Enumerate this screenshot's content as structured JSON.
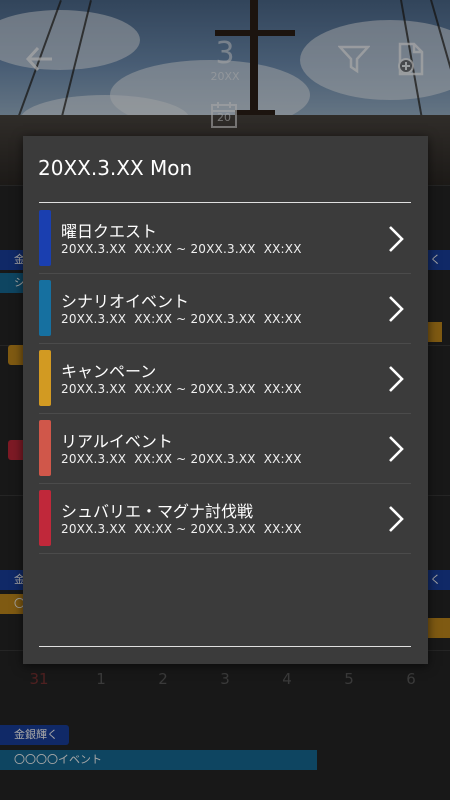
{
  "header": {
    "month": "3",
    "year": "20XX",
    "calendar_icon_day": "20",
    "icons": [
      "back-arrow-icon",
      "filter-icon",
      "add-page-icon",
      "calendar-icon"
    ]
  },
  "background": {
    "events": [
      {
        "label": "金",
        "color": "#1a3f9e"
      },
      {
        "label": "シ",
        "color": "#166a96"
      },
      {
        "label": "キ",
        "color": "#c48a1c"
      },
      {
        "label": "シ",
        "color": "#c0283a"
      },
      {
        "label": "く",
        "color": "#1a3f9e"
      },
      {
        "label": "金",
        "color": "#1a3f9e"
      },
      {
        "label": "〇",
        "color": "#c48a1c"
      },
      {
        "label": "く",
        "color": "#1a3f9e"
      },
      {
        "label": "金銀輝く",
        "color": "#1a3f9e"
      },
      {
        "label": "〇〇〇〇イベント",
        "color": "#166a96"
      }
    ],
    "day_numbers": [
      "31",
      "1",
      "2",
      "3",
      "4",
      "5",
      "6"
    ]
  },
  "dialog": {
    "title": "20XX.3.XX Mon",
    "items": [
      {
        "name": "曜日クエスト",
        "date": "20XX.3.XX  XX:XX ~ 20XX.3.XX  XX:XX",
        "color": "#1a3fb0"
      },
      {
        "name": "シナリオイベント",
        "date": "20XX.3.XX  XX:XX ~ 20XX.3.XX  XX:XX",
        "color": "#1670a0"
      },
      {
        "name": "キャンペーン",
        "date": "20XX.3.XX  XX:XX ~ 20XX.3.XX  XX:XX",
        "color": "#d29a22"
      },
      {
        "name": "リアルイベント",
        "date": "20XX.3.XX  XX:XX ~ 20XX.3.XX  XX:XX",
        "color": "#d0574a"
      },
      {
        "name": "シュバリエ・マグナ討伐戦",
        "date": "20XX.3.XX  XX:XX ~ 20XX.3.XX  XX:XX",
        "color": "#c0283a"
      }
    ]
  }
}
